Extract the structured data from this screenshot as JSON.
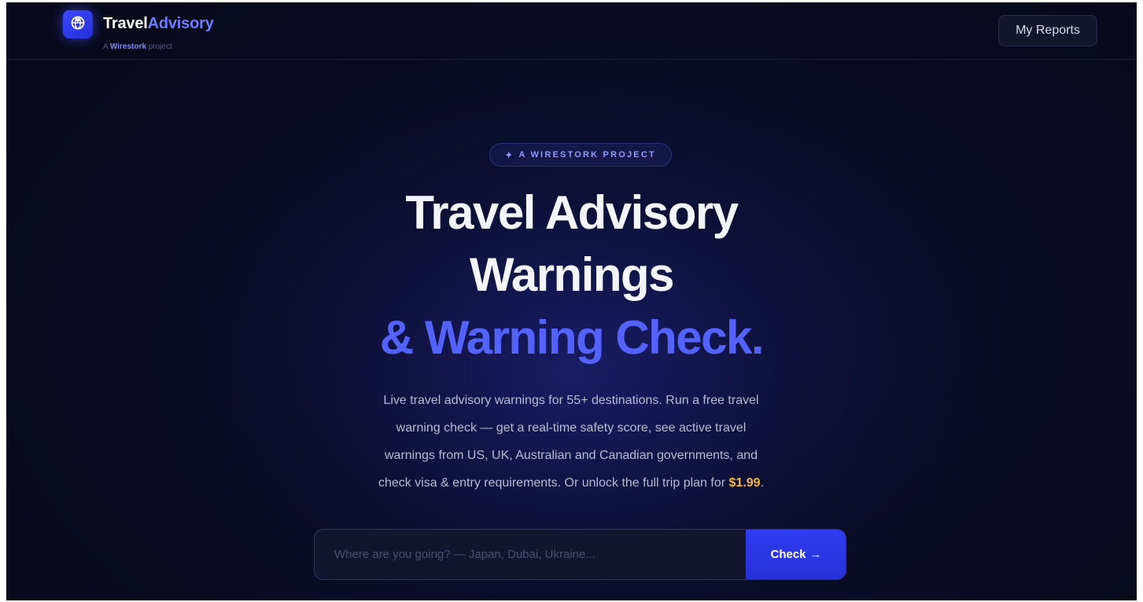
{
  "header": {
    "brand_part1": "Travel",
    "brand_part2": "Advisory",
    "sub_prefix": "A ",
    "sub_strong": "Wirestork",
    "sub_suffix": " project",
    "my_reports_label": "My Reports",
    "logo_icon": "globe-icon"
  },
  "hero": {
    "badge_icon": "✦",
    "badge_text": "A WIRESTORK PROJECT",
    "title_line1": "Travel Advisory",
    "title_line2": "Warnings",
    "title_line3": "& Warning Check.",
    "description_line1": "Live travel advisory warnings for 55+ destinations. Run a free travel",
    "description_line2": "warning check — get a real-time safety score, see active travel",
    "description_line3": "warnings from US, UK, Australian and Canadian governments, and",
    "description_line4_prefix": "check visa & entry requirements. Or unlock the full trip plan for ",
    "description_price": "$1.99",
    "description_suffix": "."
  },
  "search": {
    "placeholder": "Where are you going? — Japan, Dubai, Ukraine...",
    "value": "",
    "button_label": "Check",
    "button_arrow": "→"
  },
  "colors": {
    "accent": "#3a48ff",
    "brand_highlight": "#6d7dff",
    "price": "#f6b73c",
    "background": "#0a0b24"
  }
}
